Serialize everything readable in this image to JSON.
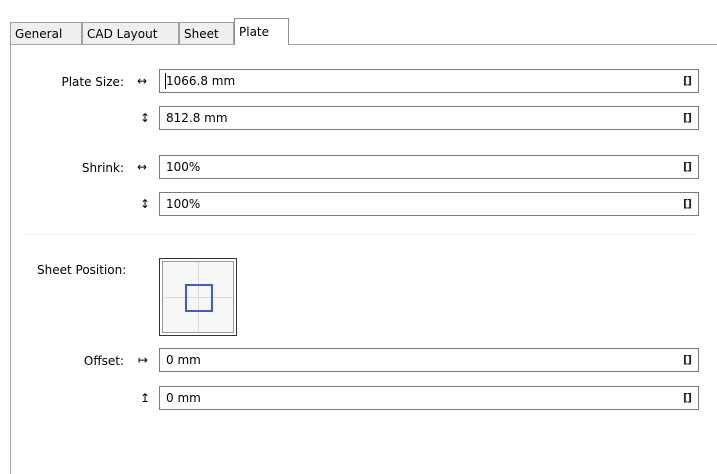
{
  "tabs": [
    {
      "label": "General",
      "active": false
    },
    {
      "label": "CAD Layout",
      "active": false
    },
    {
      "label": "Sheet",
      "active": false
    },
    {
      "label": "Plate",
      "active": true
    }
  ],
  "plate_size": {
    "label": "Plate Size:",
    "width": {
      "icon": "horizontal-arrows-icon",
      "glyph": "↔",
      "value": "1066.8 mm",
      "button": "[]"
    },
    "height": {
      "icon": "vertical-arrows-icon",
      "glyph": "↕",
      "value": "812.8 mm",
      "button": "[]"
    }
  },
  "shrink": {
    "label": "Shrink:",
    "horizontal": {
      "icon": "horizontal-arrows-icon",
      "glyph": "↔",
      "value": "100%",
      "button": "[]"
    },
    "vertical": {
      "icon": "vertical-arrows-icon",
      "glyph": "↕",
      "value": "100%",
      "button": "[]"
    }
  },
  "sheet_position": {
    "label": "Sheet Position:",
    "accent_color": "#3a5be0"
  },
  "offset": {
    "label": "Offset:",
    "horizontal": {
      "icon": "horizontal-offset-icon",
      "glyph": "↦",
      "value": "0 mm",
      "button": "[]"
    },
    "vertical": {
      "icon": "vertical-offset-icon",
      "glyph": "↥",
      "value": "0 mm",
      "button": "[]"
    }
  }
}
